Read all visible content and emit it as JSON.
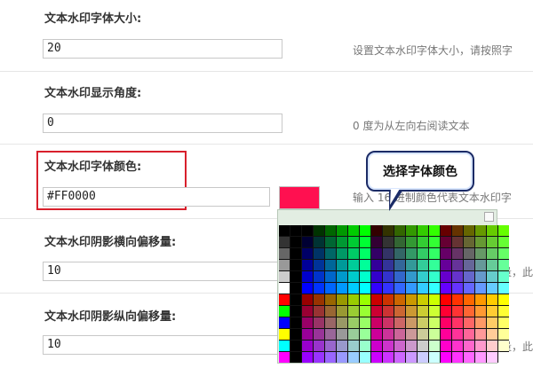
{
  "fields": {
    "font_size": {
      "label": "文本水印字体大小:",
      "value": "20",
      "hint": "设置文本水印字体大小，请按照字"
    },
    "angle": {
      "label": "文本水印显示角度:",
      "value": "0",
      "hint": "0 度为从左向右阅读文本"
    },
    "color": {
      "label": "文本水印字体颜色:",
      "value": "#FF0000",
      "hint": "输入 16 进制颜色代表文本水印字"
    },
    "shadow_x": {
      "label": "文本水印阴影横向偏移量:",
      "value": "10",
      "hint": "量，此"
    },
    "shadow_y": {
      "label": "文本水印阴影纵向偏移量:",
      "value": "10",
      "hint": "量，此"
    }
  },
  "callout": {
    "text": "选择字体颜色"
  },
  "colors": {
    "highlight_border": "#d8202c",
    "selected_swatch": "#ff1050"
  },
  "picker": {
    "left_column": [
      "#000000",
      "#333333",
      "#666666",
      "#999999",
      "#cccccc",
      "#ffffff",
      "#ff0000",
      "#00ff00",
      "#0000ff",
      "#ffff00",
      "#00ffff",
      "#ff00ff"
    ],
    "palette": [
      [
        "#000000",
        "#003300",
        "#006600",
        "#009900",
        "#00cc00",
        "#00ff00",
        "#330000",
        "#333300",
        "#336600",
        "#339900",
        "#33cc00",
        "#33ff00",
        "#660000",
        "#663300",
        "#666600",
        "#669900",
        "#66cc00",
        "#66ff00"
      ],
      [
        "#000033",
        "#003333",
        "#006633",
        "#009933",
        "#00cc33",
        "#00ff33",
        "#330033",
        "#333333",
        "#336633",
        "#339933",
        "#33cc33",
        "#33ff33",
        "#660033",
        "#663333",
        "#666633",
        "#669933",
        "#66cc33",
        "#66ff33"
      ],
      [
        "#000066",
        "#003366",
        "#006666",
        "#009966",
        "#00cc66",
        "#00ff66",
        "#330066",
        "#333366",
        "#336666",
        "#339966",
        "#33cc66",
        "#33ff66",
        "#660066",
        "#663366",
        "#666666",
        "#669966",
        "#66cc66",
        "#66ff66"
      ],
      [
        "#000099",
        "#003399",
        "#006699",
        "#009999",
        "#00cc99",
        "#00ff99",
        "#330099",
        "#333399",
        "#336699",
        "#339999",
        "#33cc99",
        "#33ff99",
        "#660099",
        "#663399",
        "#666699",
        "#669999",
        "#66cc99",
        "#66ff99"
      ],
      [
        "#0000cc",
        "#0033cc",
        "#0066cc",
        "#0099cc",
        "#00cccc",
        "#00ffcc",
        "#3300cc",
        "#3333cc",
        "#3366cc",
        "#3399cc",
        "#33cccc",
        "#33ffcc",
        "#6600cc",
        "#6633cc",
        "#6666cc",
        "#6699cc",
        "#66cccc",
        "#66ffcc"
      ],
      [
        "#0000ff",
        "#0033ff",
        "#0066ff",
        "#0099ff",
        "#00ccff",
        "#00ffff",
        "#3300ff",
        "#3333ff",
        "#3366ff",
        "#3399ff",
        "#33ccff",
        "#33ffff",
        "#6600ff",
        "#6633ff",
        "#6666ff",
        "#6699ff",
        "#66ccff",
        "#66ffff"
      ],
      [
        "#990000",
        "#993300",
        "#996600",
        "#999900",
        "#99cc00",
        "#99ff00",
        "#cc0000",
        "#cc3300",
        "#cc6600",
        "#cc9900",
        "#cccc00",
        "#ccff00",
        "#ff0000",
        "#ff3300",
        "#ff6600",
        "#ff9900",
        "#ffcc00",
        "#ffff00"
      ],
      [
        "#990033",
        "#993333",
        "#996633",
        "#999933",
        "#99cc33",
        "#99ff33",
        "#cc0033",
        "#cc3333",
        "#cc6633",
        "#cc9933",
        "#cccc33",
        "#ccff33",
        "#ff0033",
        "#ff3333",
        "#ff6633",
        "#ff9933",
        "#ffcc33",
        "#ffff33"
      ],
      [
        "#990066",
        "#993366",
        "#996666",
        "#999966",
        "#99cc66",
        "#99ff66",
        "#cc0066",
        "#cc3366",
        "#cc6666",
        "#cc9966",
        "#cccc66",
        "#ccff66",
        "#ff0066",
        "#ff3366",
        "#ff6666",
        "#ff9966",
        "#ffcc66",
        "#ffff66"
      ],
      [
        "#990099",
        "#993399",
        "#996699",
        "#999999",
        "#99cc99",
        "#99ff99",
        "#cc0099",
        "#cc3399",
        "#cc6699",
        "#cc9999",
        "#cccc99",
        "#ccff99",
        "#ff0099",
        "#ff3399",
        "#ff6699",
        "#ff9999",
        "#ffcc99",
        "#ffff99"
      ],
      [
        "#9900cc",
        "#9933cc",
        "#9966cc",
        "#9999cc",
        "#99cccc",
        "#99ffcc",
        "#cc00cc",
        "#cc33cc",
        "#cc66cc",
        "#cc99cc",
        "#cccccc",
        "#ccffcc",
        "#ff00cc",
        "#ff33cc",
        "#ff66cc",
        "#ff99cc",
        "#ffcccc",
        "#ffffcc"
      ],
      [
        "#9900ff",
        "#9933ff",
        "#9966ff",
        "#9999ff",
        "#99ccff",
        "#99ffff",
        "#cc00ff",
        "#cc33ff",
        "#cc66ff",
        "#cc99ff",
        "#ccccff",
        "#ccffff",
        "#ff00ff",
        "#ff33ff",
        "#ff66ff",
        "#ff99ff",
        "#ffccff",
        "#ffffff"
      ]
    ]
  }
}
